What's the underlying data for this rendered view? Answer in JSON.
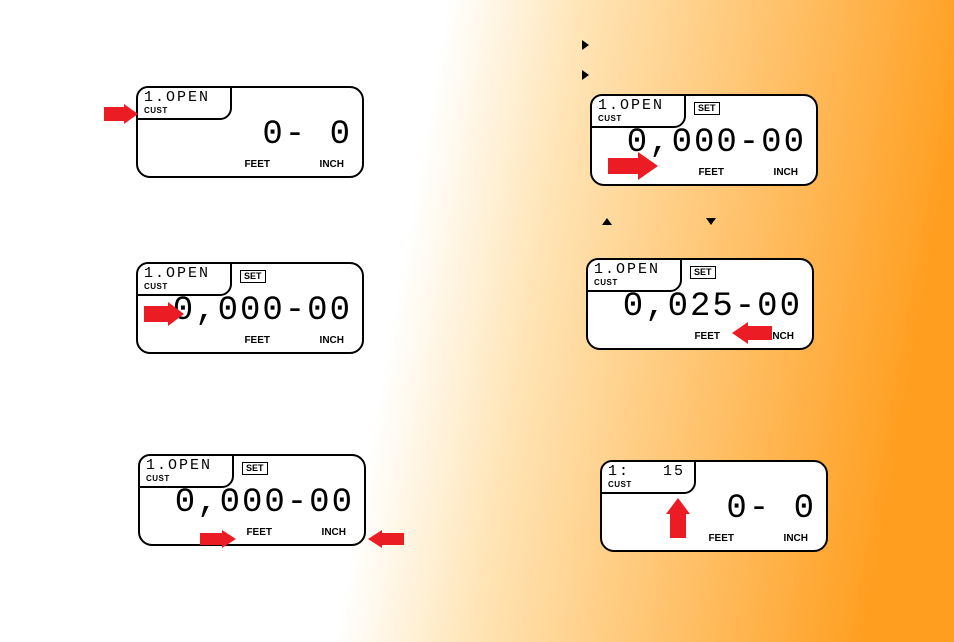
{
  "labels": {
    "cust": "CUST",
    "set": "SET",
    "feet": "FEET",
    "inch": "INCH"
  },
  "panels": {
    "p1": {
      "tab_top": "1.OPEN",
      "digits": "0- 0"
    },
    "p2": {
      "tab_top": "1.OPEN",
      "digits": "0,000-00"
    },
    "p3": {
      "tab_top": "1.OPEN",
      "digits": "0,000-00"
    },
    "p4": {
      "tab_top": "1.OPEN",
      "digits": "0,000-00"
    },
    "p5": {
      "tab_top": "1.OPEN",
      "digits": "0,025-00"
    },
    "p6": {
      "tab_top": "1:   15",
      "digits": "0- 0"
    }
  }
}
